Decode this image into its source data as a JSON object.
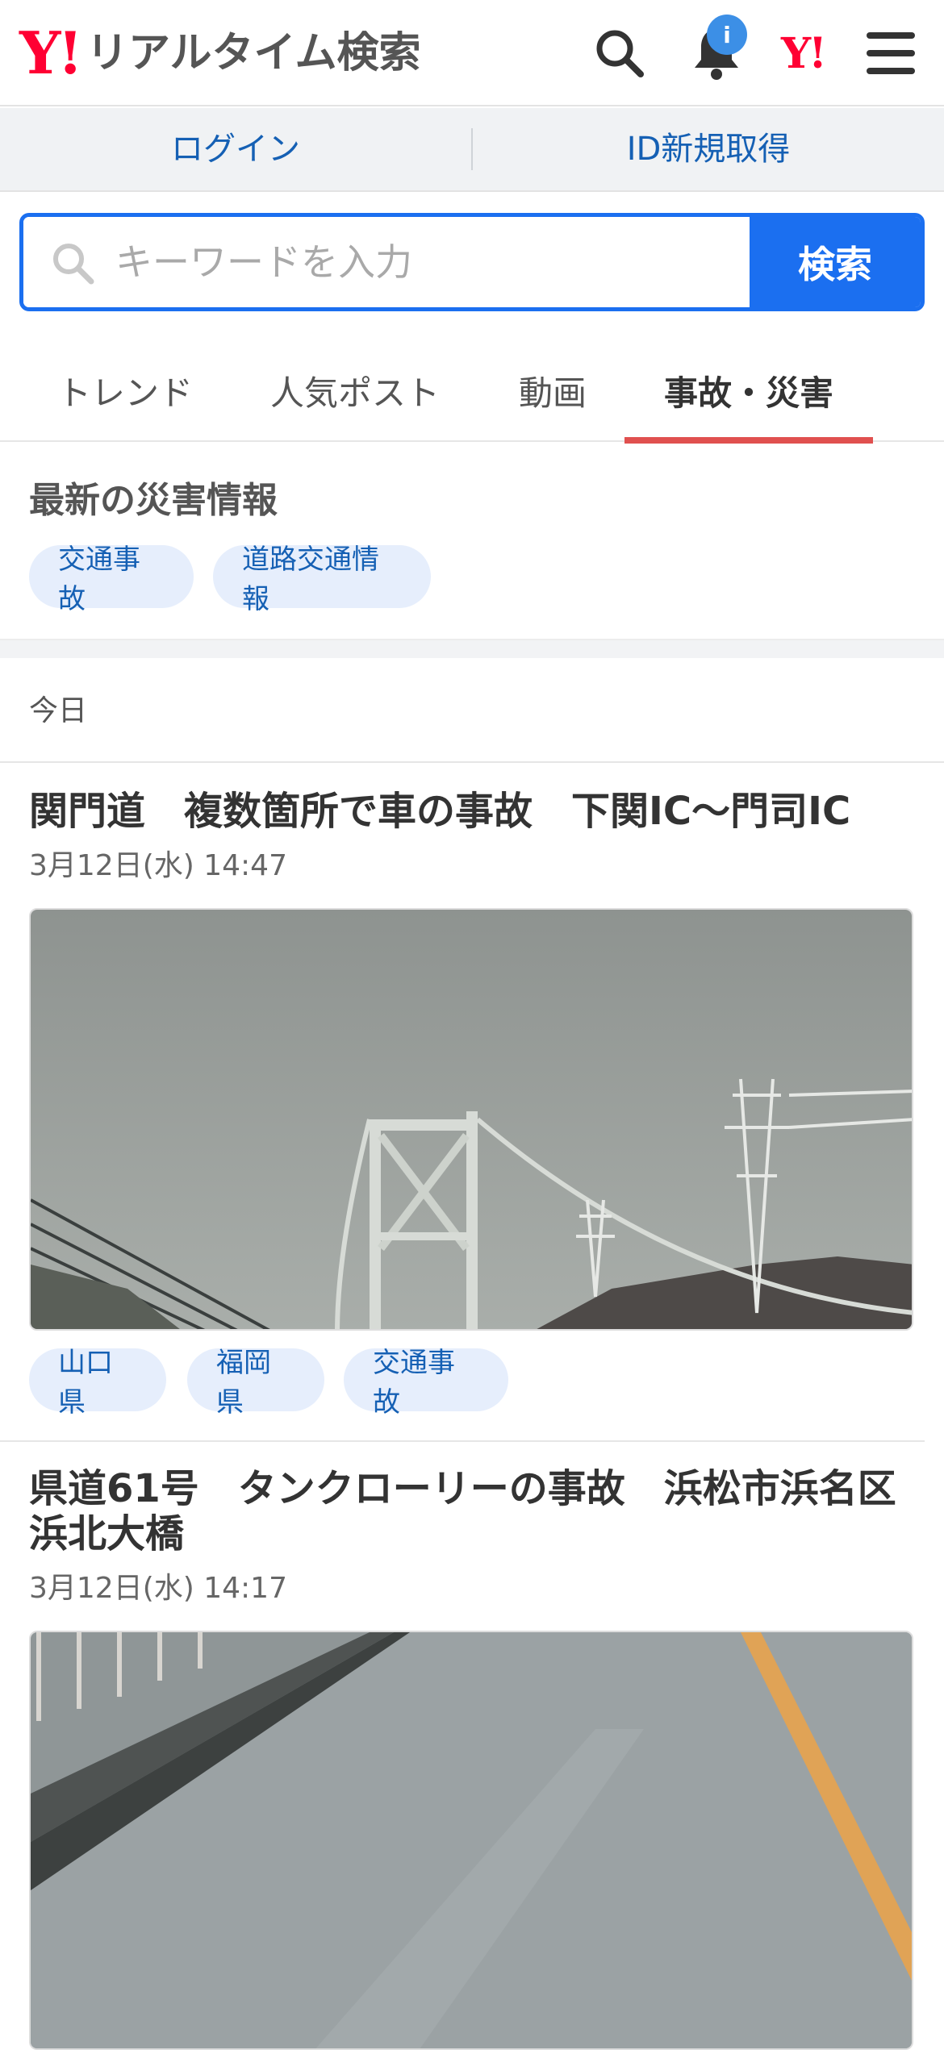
{
  "header": {
    "logo_mark": "Y!",
    "logo_text": "リアルタイム検索",
    "notification_badge": "i",
    "yahoo_mark": "Y!"
  },
  "account": {
    "login": "ログイン",
    "signup": "ID新規取得"
  },
  "search": {
    "placeholder": "キーワードを入力",
    "button": "検索"
  },
  "tabs": [
    {
      "label": "トレンド",
      "active": false
    },
    {
      "label": "人気ポスト",
      "active": false
    },
    {
      "label": "動画",
      "active": false
    },
    {
      "label": "事故・災害",
      "active": true
    }
  ],
  "disaster": {
    "title": "最新の災害情報",
    "chips": [
      "交通事故",
      "道路交通情報"
    ]
  },
  "feed": {
    "date_heading": "今日",
    "articles": [
      {
        "title": "関門道　複数箇所で車の事故　下関IC～門司IC",
        "date": "3月12日(水) 14:47",
        "tags": [
          "山口県",
          "福岡県",
          "交通事故"
        ]
      },
      {
        "title": "県道61号　タンクローリーの事故　浜松市浜名区浜北大橋",
        "date": "3月12日(水) 14:17",
        "tags": []
      }
    ]
  },
  "colors": {
    "accent": "#1b6ff0",
    "brand_red": "#ff0033",
    "tab_underline": "#e0504f",
    "link": "#1560b4"
  },
  "icons": [
    "search-icon",
    "bell-icon",
    "menu-icon"
  ]
}
